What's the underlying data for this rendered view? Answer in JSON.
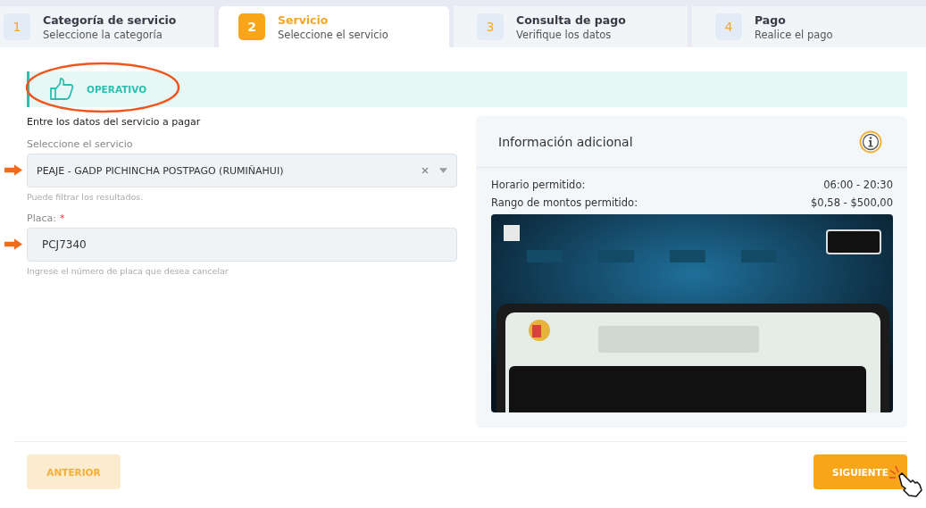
{
  "steps": [
    {
      "number": "1",
      "title": "Categoría de servicio",
      "subtitle": "Seleccione la categoría",
      "selected": false
    },
    {
      "number": "2",
      "title": "Servicio",
      "subtitle": "Seleccione el servicio",
      "selected": true
    },
    {
      "number": "3",
      "title": "Consulta de pago",
      "subtitle": "Verifique los datos",
      "selected": false
    },
    {
      "number": "4",
      "title": "Pago",
      "subtitle": "Realice el pago",
      "selected": false
    }
  ],
  "status": {
    "label": "OPERATIVO",
    "highlighted": true
  },
  "form": {
    "heading": "Entre los datos del servicio a pagar",
    "fields": [
      {
        "kind": "select",
        "label": "Seleccione el servicio",
        "value": "PEAJE - GADP PICHINCHA POSTPAGO (RUMIÑAHUI)",
        "hint": "Puede filtrar los resultados.",
        "highlighted": true
      },
      {
        "kind": "text",
        "label": "Placa:",
        "required_mark": "*",
        "value": "PCJ7340",
        "hint": "Ingrese el número de placa que desea cancelar",
        "highlighted": true
      }
    ]
  },
  "info": {
    "title": "Información adicional",
    "rows": [
      {
        "label": "Horario permitido:",
        "value": "06:00 - 20:30"
      },
      {
        "label": "Rango de montos permitido:",
        "value": "$0,58 - $500,00"
      }
    ]
  },
  "buttons": [
    {
      "label": "ANTERIOR",
      "kind": "secondary",
      "disabled": true
    },
    {
      "label": "SIGUIENTE",
      "kind": "primary",
      "disabled": false,
      "pointer": true
    }
  ]
}
